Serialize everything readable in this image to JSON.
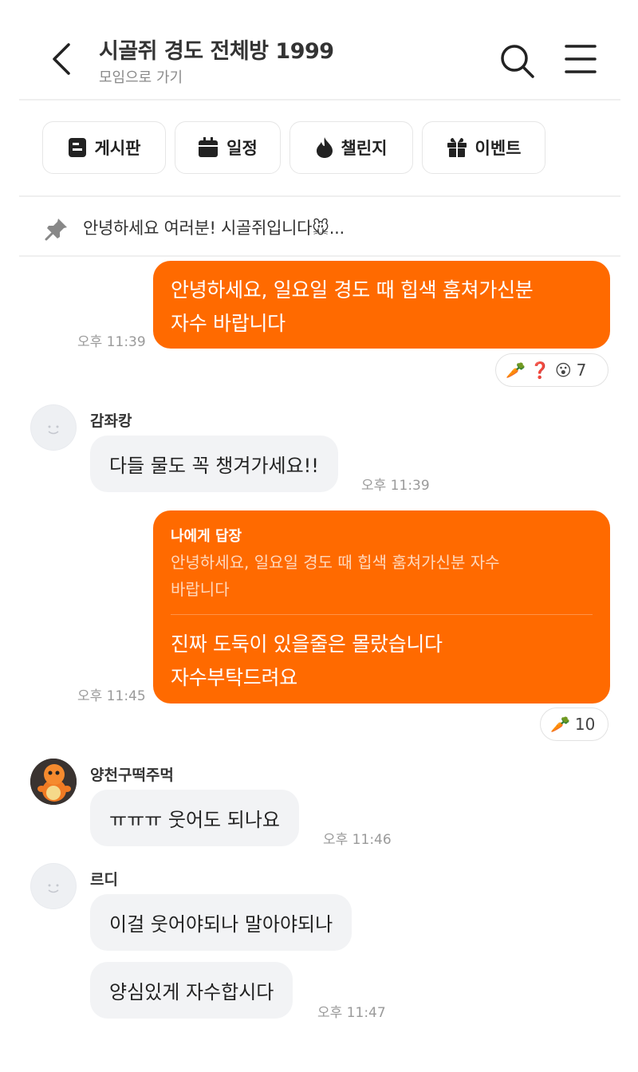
{
  "header": {
    "title": "시골쥐 경도 전체방 1999",
    "subtitle": "모임으로 가기"
  },
  "tabs": [
    {
      "label": "게시판",
      "icon": "board-icon"
    },
    {
      "label": "일정",
      "icon": "calendar-icon"
    },
    {
      "label": "챌린지",
      "icon": "flame-icon"
    },
    {
      "label": "이벤트",
      "icon": "gift-icon"
    }
  ],
  "notice": {
    "text": "안녕하세요 여러분! 시골쥐입니다🐭..."
  },
  "messages": {
    "m1": {
      "lines": [
        "안녕하세요, 일요일 경도 때 힙색 훔쳐가신분",
        "자수 바랍니다"
      ],
      "time": "오후 11:39",
      "reactions": [
        "🥕",
        "❓",
        "😮"
      ],
      "reaction_count": "7"
    },
    "m2": {
      "sender": "감좌캉",
      "text": "다들 물도 꼭 챙겨가세요!!",
      "time": "오후 11:39"
    },
    "m3": {
      "reply_label": "나에게 답장",
      "quote_lines": [
        "안녕하세요, 일요일 경도 때 힙색 훔쳐가신분 자수",
        "바랍니다"
      ],
      "lines": [
        "진짜 도둑이 있을줄은 몰랐습니다",
        "자수부탁드려요"
      ],
      "time": "오후 11:45",
      "reactions": [
        "🥕"
      ],
      "reaction_count": "10"
    },
    "m4": {
      "sender": "양천구떡주먹",
      "text": "ㅠㅠㅠ 웃어도 되나요",
      "time": "오후 11:46"
    },
    "m5": {
      "sender": "르디",
      "text1": "이걸 웃어야되나 말아야되나",
      "text2": "양심있게 자수합시다",
      "time": "오후 11:47"
    }
  },
  "colors": {
    "accent": "#ff6a00",
    "bubble_other": "#f2f3f5",
    "time_text": "#9a9a9a"
  }
}
